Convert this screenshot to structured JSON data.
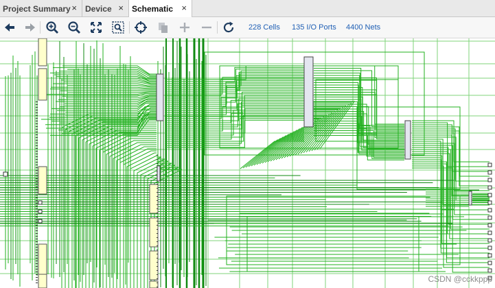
{
  "tabs": [
    {
      "label": "Project Summary",
      "active": false
    },
    {
      "label": "Device",
      "active": false
    },
    {
      "label": "Schematic",
      "active": true
    }
  ],
  "tab_close_glyph": "×",
  "toolbar": {
    "buttons": [
      {
        "name": "back-button",
        "icon": "arrow-left-icon"
      },
      {
        "name": "forward-button",
        "icon": "arrow-right-icon"
      },
      {
        "name": "zoom-in-button",
        "icon": "zoom-in-icon"
      },
      {
        "name": "zoom-out-button",
        "icon": "zoom-out-icon"
      },
      {
        "name": "zoom-fit-button",
        "icon": "fit-icon"
      },
      {
        "name": "zoom-area-button",
        "icon": "zoom-area-icon"
      },
      {
        "name": "select-button",
        "icon": "crosshair-icon"
      },
      {
        "name": "copy-button",
        "icon": "copy-icon"
      },
      {
        "name": "expand-button",
        "icon": "plus-icon"
      },
      {
        "name": "collapse-button",
        "icon": "minus-icon"
      },
      {
        "name": "refresh-button",
        "icon": "refresh-icon"
      }
    ],
    "stats": {
      "cells": "228 Cells",
      "io_ports": "135 I/O Ports",
      "nets": "4400 Nets"
    }
  },
  "schematic": {
    "wire_color": "#21b01e",
    "wire_dark": "#0f8a10",
    "cell_fill": "#ffffcc",
    "block_fill": "#e4e6f0"
  },
  "watermark": "CSDN @cckkppp"
}
